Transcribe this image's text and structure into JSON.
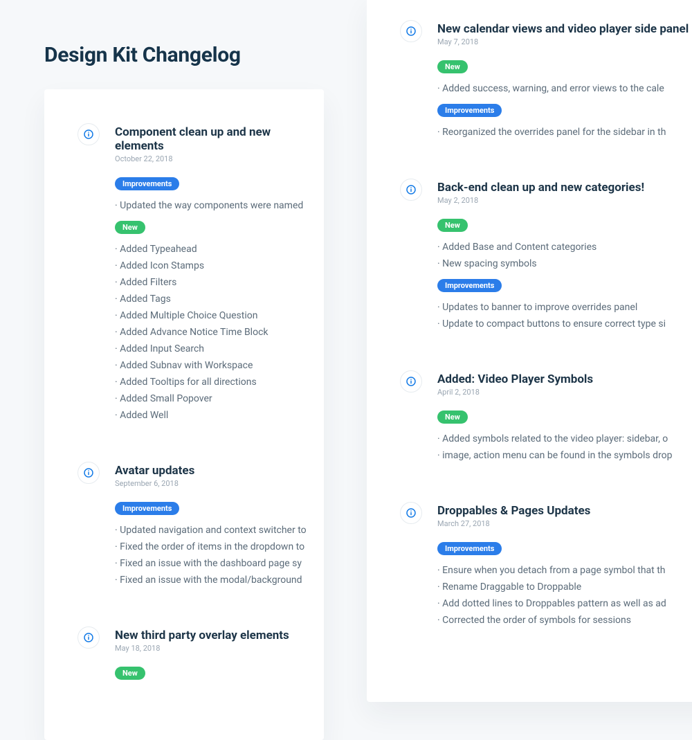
{
  "title": "Design Kit Changelog",
  "badges": {
    "improvements": "Improvements",
    "new": "New"
  },
  "left": {
    "entries": [
      {
        "title": "Component clean up and new elements",
        "date": "October 22, 2018",
        "sections": [
          {
            "type": "improvements",
            "items": [
              "Updated the way components were named"
            ]
          },
          {
            "type": "new",
            "items": [
              "Added Typeahead",
              "Added Icon Stamps",
              "Added Filters",
              "Added Tags",
              "Added Multiple Choice Question",
              "Added Advance Notice Time Block",
              "Added Input Search",
              "Added Subnav with Workspace",
              "Added Tooltips for all directions",
              "Added Small Popover",
              "Added Well"
            ]
          }
        ]
      },
      {
        "title": "Avatar updates",
        "date": "September 6, 2018",
        "sections": [
          {
            "type": "improvements",
            "items": [
              "Updated navigation and context switcher to",
              "Fixed the order of items in the dropdown to",
              "Fixed an issue with the dashboard page sy",
              "Fixed an issue with the modal/background"
            ]
          }
        ]
      },
      {
        "title": "New third party overlay elements",
        "date": "May 18, 2018",
        "sections": [
          {
            "type": "new",
            "items": []
          }
        ]
      }
    ]
  },
  "right": {
    "entries": [
      {
        "title": "New calendar views and video player side panel reo",
        "date": "May 7, 2018",
        "sections": [
          {
            "type": "new",
            "items": [
              "Added success, warning, and error views to the cale"
            ]
          },
          {
            "type": "improvements",
            "items": [
              "Reorganized the overrides panel for the sidebar in th"
            ]
          }
        ]
      },
      {
        "title": "Back-end clean up and new categories!",
        "date": "May 2, 2018",
        "sections": [
          {
            "type": "new",
            "items": [
              "Added Base and Content categories",
              "New spacing symbols"
            ]
          },
          {
            "type": "improvements",
            "items": [
              "Updates to banner to improve overrides panel",
              "Update to compact buttons to ensure correct type si"
            ]
          }
        ]
      },
      {
        "title": "Added: Video Player Symbols",
        "date": "April 2, 2018",
        "sections": [
          {
            "type": "new",
            "items": [
              "Added symbols related to the video player: sidebar, o",
              "image, action menu can be found in the symbols drop"
            ]
          }
        ]
      },
      {
        "title": "Droppables & Pages Updates",
        "date": "March 27, 2018",
        "sections": [
          {
            "type": "improvements",
            "items": [
              "Ensure when you detach from a page symbol that th",
              "Rename Draggable to Droppable",
              "Add dotted lines to Droppables pattern as well as ad",
              "Corrected the order of symbols for sessions"
            ]
          }
        ]
      }
    ]
  }
}
